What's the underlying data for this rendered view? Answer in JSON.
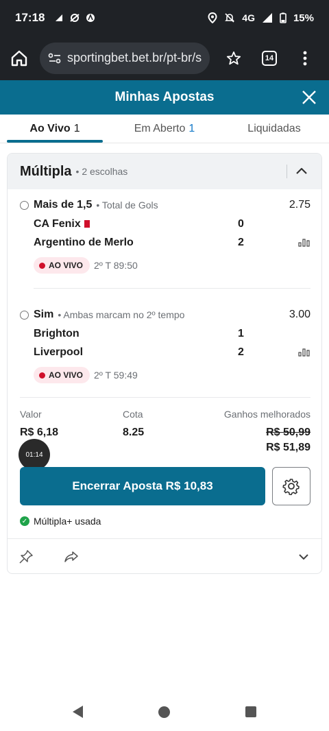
{
  "status": {
    "time": "17:18",
    "network": "4G",
    "battery": "15%"
  },
  "browser": {
    "url": "sportingbet.bet.br/pt-br/s",
    "tab_count": "14"
  },
  "header": {
    "title": "Minhas Apostas"
  },
  "tabs": [
    {
      "label": "Ao Vivo",
      "count": "1"
    },
    {
      "label": "Em Aberto",
      "count": "1"
    },
    {
      "label": "Liquidadas",
      "count": ""
    }
  ],
  "bet": {
    "title": "Múltipla",
    "subtitle": "2 escolhas",
    "selections": [
      {
        "pick": "Mais de 1,5",
        "market": "Total de Gols",
        "odds": "2.75",
        "teams": [
          {
            "name": "CA Fenix",
            "score": "0"
          },
          {
            "name": "Argentino de Merlo",
            "score": "2"
          }
        ],
        "live_label": "AO VIVO",
        "live_time": "2º T 89:50"
      },
      {
        "pick": "Sim",
        "market": "Ambas marcam no 2º tempo",
        "odds": "3.00",
        "teams": [
          {
            "name": "Brighton",
            "score": "1"
          },
          {
            "name": "Liverpool",
            "score": "2"
          }
        ],
        "live_label": "AO VIVO",
        "live_time": "2º T 59:49"
      }
    ],
    "summary": {
      "stake_label": "Valor",
      "odds_label": "Cota",
      "winnings_label": "Ganhos melhorados",
      "stake": "R$ 6,18",
      "odds": "8.25",
      "old_winnings": "R$ 50,99",
      "new_winnings": "R$ 51,89"
    },
    "timer": "01:14",
    "cashout_label": "Encerrar Aposta R$ 10,83",
    "multiple_used": "Múltipla+ usada"
  },
  "colors": {
    "brand": "#0a6d8f",
    "live_red": "#d0102b",
    "count_blue": "#1479c8",
    "success_green": "#1fa34a"
  }
}
